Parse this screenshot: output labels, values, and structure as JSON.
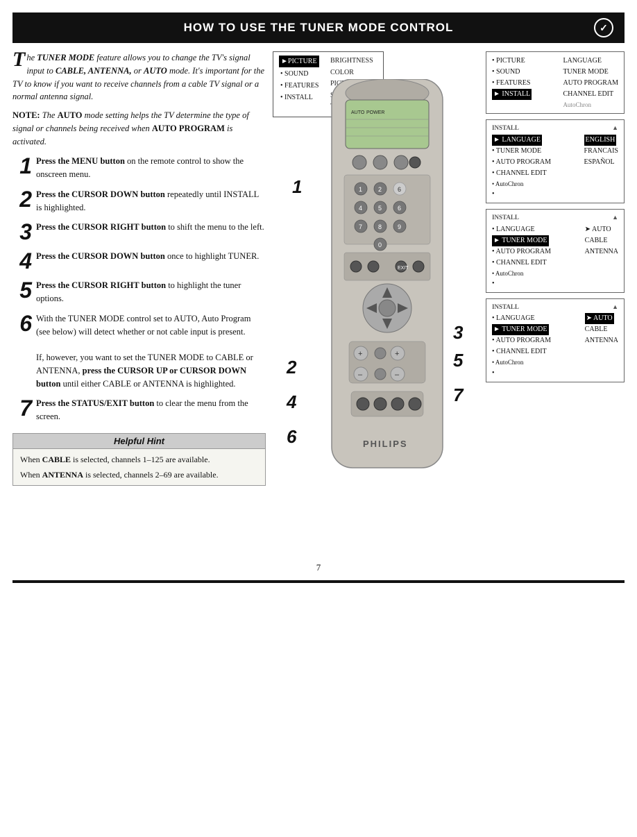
{
  "header": {
    "title": "How to Use the Tuner Mode Control",
    "icon": "Z"
  },
  "intro": {
    "drop_cap": "T",
    "text": "he TUNER MODE feature allows you to change the TV's signal input to CABLE, ANTENNA, or AUTO mode. It's important for the TV to know if you want to receive channels from a cable TV signal or a normal antenna signal.",
    "note_label": "NOTE:",
    "note_text": " The AUTO mode setting helps the TV determine the type of signal or channels being received when AUTO PROGRAM is activated."
  },
  "steps": [
    {
      "number": "1",
      "text": "Press the MENU button on the remote control to show the onscreen menu."
    },
    {
      "number": "2",
      "text": "Press the CURSOR DOWN button repeatedly until INSTALL is highlighted."
    },
    {
      "number": "3",
      "text": "Press the CURSOR RIGHT button to shift the menu to the left."
    },
    {
      "number": "4",
      "text": "Press the CURSOR DOWN button once to highlight TUNER."
    },
    {
      "number": "5",
      "text": "Press the CURSOR RIGHT button to highlight the tuner options."
    },
    {
      "number": "6",
      "text": "With the TUNER MODE control set to AUTO, Auto Program (see below) will detect whether or not cable input is present.\n\nIf, however, you want to set the TUNER MODE to CABLE or ANTENNA, press the CURSOR UP or CURSOR DOWN button until either CABLE or ANTENNA is highlighted."
    },
    {
      "number": "7",
      "text": "Press the STATUS/EXIT button to clear the menu from the screen."
    }
  ],
  "hint": {
    "title": "Helpful Hint",
    "items": [
      "When CABLE is selected, channels 1–125 are available.",
      "When ANTENNA is selected, channels 2–69 are available."
    ]
  },
  "screens": [
    {
      "id": "screen1",
      "label": "",
      "rows": [
        {
          "bullet": "►",
          "text": "PICTURE",
          "right": "BRIGHTNESS",
          "active": true
        },
        {
          "bullet": "•",
          "text": "SOUND",
          "right": "COLOR",
          "active": false
        },
        {
          "bullet": "•",
          "text": "FEATURES",
          "right": "PICTURE",
          "active": false
        },
        {
          "bullet": "•",
          "text": "INSTALL",
          "right": "SHARPNESS",
          "active": false
        },
        {
          "bullet": "",
          "text": "",
          "right": "TINT",
          "active": false
        }
      ]
    },
    {
      "id": "screen2",
      "label": "",
      "rows": [
        {
          "bullet": "•",
          "text": "PICTURE",
          "right": "LANGUAGE",
          "active": false
        },
        {
          "bullet": "•",
          "text": "SOUND",
          "right": "TUNER MODE",
          "active": false
        },
        {
          "bullet": "•",
          "text": "FEATURES",
          "right": "AUTO PROGRAM",
          "active": false
        },
        {
          "bullet": "►",
          "text": "INSTALL",
          "right": "CHANNEL EDIT",
          "active": true
        },
        {
          "bullet": "",
          "text": "",
          "right": "AutoChron",
          "active": false
        }
      ]
    },
    {
      "id": "screen3",
      "label": "INSTALL",
      "rows": [
        {
          "bullet": "►",
          "text": "LANGUAGE",
          "right": "ENGLISH",
          "active": true
        },
        {
          "bullet": "•",
          "text": "TUNER MODE",
          "right": "FRANCAIS",
          "active": false
        },
        {
          "bullet": "•",
          "text": "AUTO PROGRAM",
          "right": "ESPAÑOL",
          "active": false
        },
        {
          "bullet": "•",
          "text": "CHANNEL EDIT",
          "right": "",
          "active": false
        },
        {
          "bullet": "•",
          "text": "AutoChron",
          "right": "",
          "active": false
        },
        {
          "bullet": "•",
          "text": "",
          "right": "",
          "active": false
        }
      ]
    },
    {
      "id": "screen4",
      "label": "INSTALL",
      "rows": [
        {
          "bullet": "•",
          "text": "LANGUAGE",
          "right": "",
          "active": false
        },
        {
          "bullet": "►",
          "text": "TUNER MODE",
          "right": "AUTO",
          "active": true
        },
        {
          "bullet": "•",
          "text": "AUTO PROGRAM",
          "right": "CABLE",
          "active": false
        },
        {
          "bullet": "•",
          "text": "CHANNEL EDIT",
          "right": "ANTENNA",
          "active": false
        },
        {
          "bullet": "•",
          "text": "AutoChron",
          "right": "",
          "active": false
        },
        {
          "bullet": "•",
          "text": "",
          "right": "",
          "active": false
        }
      ]
    },
    {
      "id": "screen5",
      "label": "INSTALL",
      "rows": [
        {
          "bullet": "•",
          "text": "LANGUAGE",
          "right": "",
          "active": false
        },
        {
          "bullet": "►",
          "text": "TUNER MODE",
          "right": "AUTO",
          "active": true,
          "right_selected": true
        },
        {
          "bullet": "•",
          "text": "AUTO PROGRAM",
          "right": "CABLE",
          "active": false
        },
        {
          "bullet": "•",
          "text": "CHANNEL EDIT",
          "right": "ANTENNA",
          "active": false
        },
        {
          "bullet": "•",
          "text": "AutoChron",
          "right": "",
          "active": false
        },
        {
          "bullet": "•",
          "text": "",
          "right": "",
          "active": false
        }
      ]
    }
  ],
  "page_number": "7",
  "remote_step_numbers": [
    "1",
    "2",
    "4",
    "6",
    "3",
    "5",
    "7"
  ]
}
